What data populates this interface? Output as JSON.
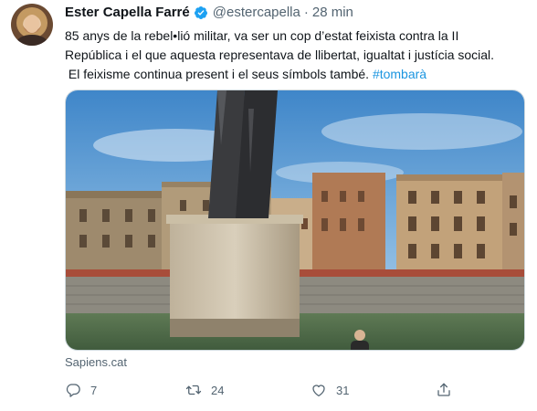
{
  "tweet": {
    "author_name": "Ester Capella Farré",
    "author_handle": "@estercapella",
    "separator": "·",
    "time": "28 min",
    "text_lines": [
      "85 anys de la rebel•lió militar, va ser un cop d’estat feixista contra la II",
      "República i el que aquesta representava de llibertat, igualtat i justícia social.",
      " El feixisme continua present i el seus símbols també. "
    ],
    "hashtag": "#tombarà",
    "link_source": "Sapiens.cat"
  },
  "actions": {
    "reply_count": "7",
    "retweet_count": "24",
    "like_count": "31"
  },
  "icons": {
    "verified": "verified-badge-icon",
    "reply": "reply-icon",
    "retweet": "retweet-icon",
    "like": "heart-icon",
    "share": "share-icon"
  },
  "colors": {
    "accent": "#1da1f2",
    "hashtag": "#1b95e0",
    "secondary_text": "#536471"
  }
}
